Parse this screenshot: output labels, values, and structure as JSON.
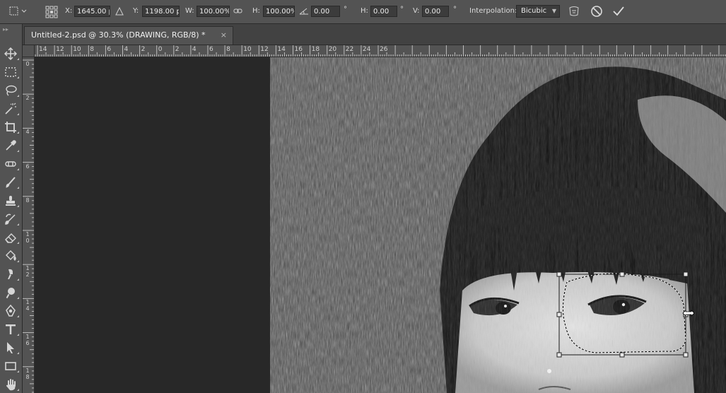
{
  "options_bar": {
    "x_label": "X:",
    "x_value": "1645.00 px",
    "y_label": "Y:",
    "y_value": "1198.00 px",
    "w_label": "W:",
    "w_value": "100.00%",
    "h_label": "H:",
    "h_value": "100.00%",
    "angle_value": "0.00",
    "angle_unit": "°",
    "hskew_label": "H:",
    "hskew_value": "0.00",
    "hskew_unit": "°",
    "vskew_label": "V:",
    "vskew_value": "0.00",
    "vskew_unit": "°",
    "interp_label": "Interpolation:",
    "interp_value": "Bicubic"
  },
  "document_tab": {
    "title": "Untitled-2.psd @ 30.3% (DRAWING, RGB/8) *",
    "close": "×"
  },
  "tools": [
    "move",
    "rect-marquee",
    "lasso",
    "magic-wand",
    "crop",
    "eyedropper",
    "spot-healing",
    "brush",
    "clone-stamp",
    "history-brush",
    "eraser",
    "paint-bucket",
    "blur",
    "dodge",
    "pen",
    "type",
    "path-select",
    "rectangle",
    "hand"
  ],
  "ruler_top": [
    "14",
    "12",
    "10",
    "8",
    "6",
    "4",
    "2",
    "0",
    "2",
    "4",
    "6",
    "8",
    "10",
    "12",
    "14",
    "16",
    "18",
    "20",
    "22",
    "24",
    "26"
  ],
  "ruler_left": [
    "0",
    "2",
    "4",
    "6",
    "8",
    "1 0",
    "1 2",
    "1 4",
    "1 6",
    "1 8"
  ],
  "colors": {
    "panel": "#535353",
    "workspace": "#282828",
    "tab_bar": "#424242"
  }
}
